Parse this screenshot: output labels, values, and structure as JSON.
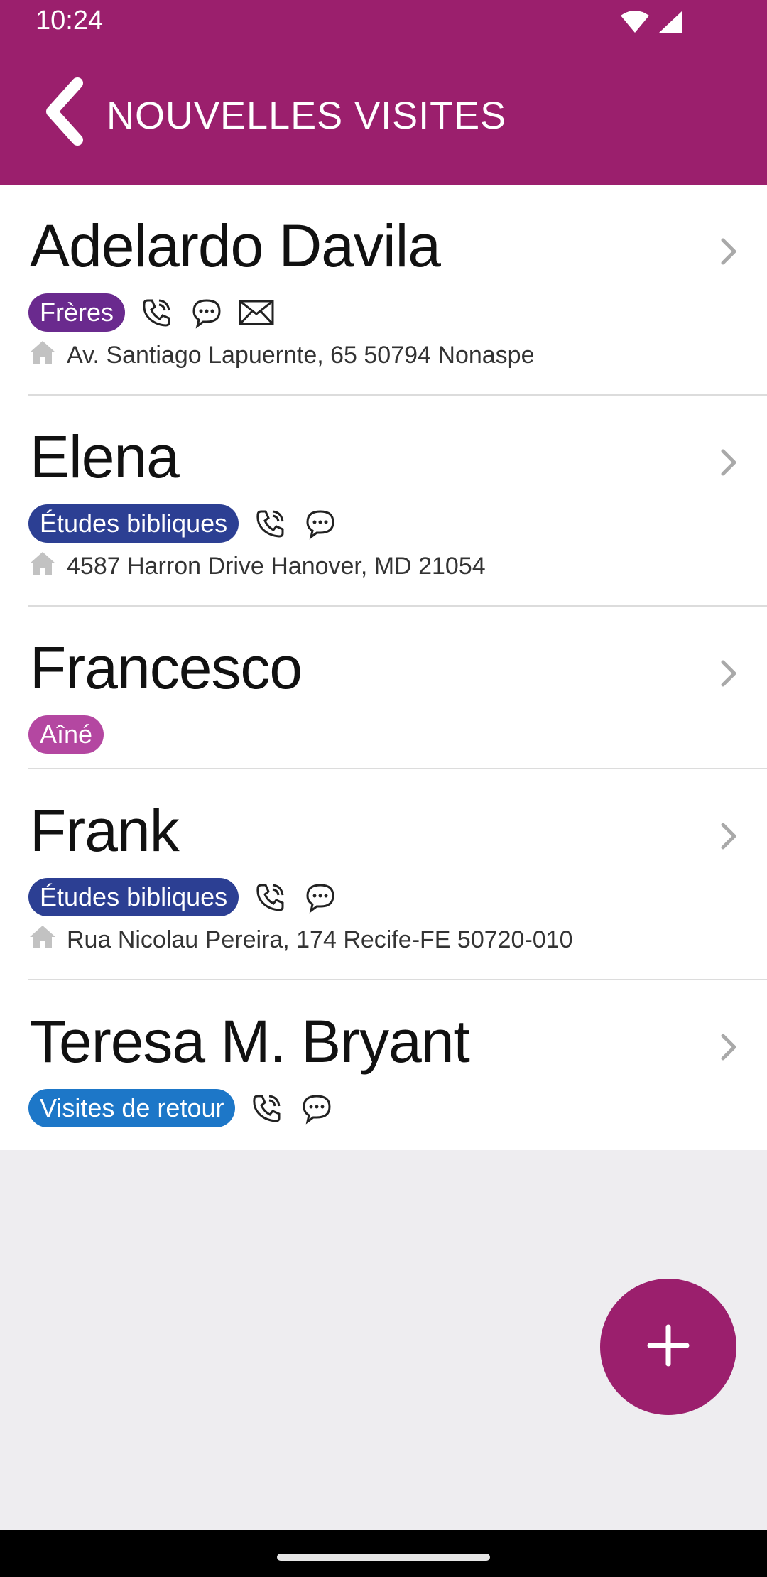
{
  "status_bar": {
    "time": "10:24",
    "icons": [
      "wifi-icon",
      "signal-icon"
    ]
  },
  "header": {
    "back_icon": "chevron-left-icon",
    "title": "NOUVELLES VISITES"
  },
  "colors": {
    "brand": "#9b1f6d",
    "badge_freres": "#6a2a8e",
    "badge_etudes": "#2c3f93",
    "badge_aine": "#b447a1",
    "badge_retour": "#1d77c8"
  },
  "contacts": [
    {
      "name": "Adelardo Davila",
      "badge": "Frères",
      "actions": [
        "phone-icon",
        "chat-icon",
        "mail-icon"
      ],
      "address": "Av. Santiago Lapuernte, 65 50794 Nonaspe"
    },
    {
      "name": "Elena",
      "badge": "Études bibliques",
      "actions": [
        "phone-icon",
        "chat-icon"
      ],
      "address": "4587 Harron Drive Hanover, MD 21054"
    },
    {
      "name": "Francesco",
      "badge": "Aîné",
      "actions": [],
      "address": ""
    },
    {
      "name": "Frank",
      "badge": "Études bibliques",
      "actions": [
        "phone-icon",
        "chat-icon"
      ],
      "address": "Rua Nicolau Pereira, 174 Recife-FE 50720-010"
    },
    {
      "name": "Teresa M. Bryant",
      "badge": "Visites de retour",
      "actions": [
        "phone-icon",
        "chat-icon"
      ],
      "address": ""
    }
  ],
  "fab": {
    "icon": "plus-icon"
  }
}
